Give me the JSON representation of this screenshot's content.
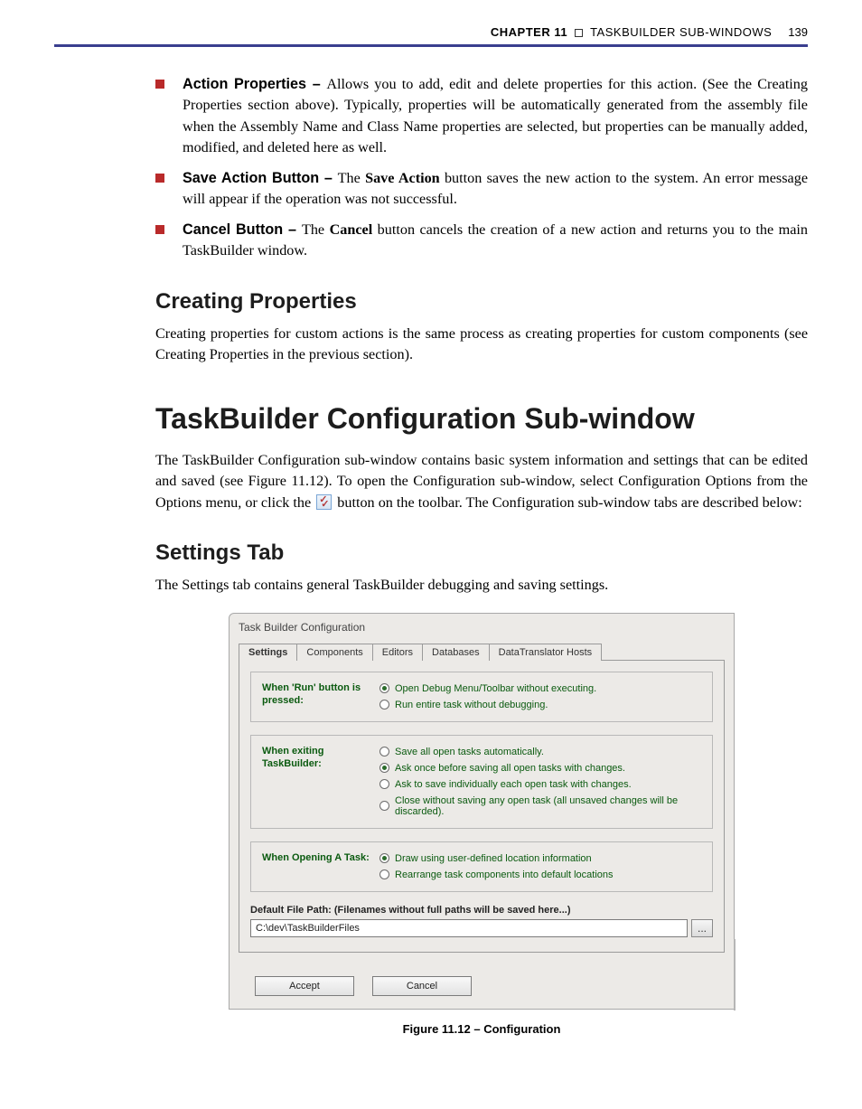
{
  "header": {
    "chapter_label": "CHAPTER 11",
    "chapter_title": "TASKBUILDER SUB-WINDOWS",
    "page_number": "139"
  },
  "bullets": [
    {
      "term": "Action Properties – ",
      "text": "Allows you to add, edit and delete properties for this action. (See the Creating Properties section above). Typically, properties will be automatically generated from the assembly file when the Assembly Name and Class Name properties are selected, but properties can be manually added, modified, and deleted here as well."
    },
    {
      "term": "Save Action Button – ",
      "pre": "The ",
      "strong": "Save Action",
      "post": " button saves the new action to the system. An error message will appear if the operation was not successful."
    },
    {
      "term": "Cancel Button – ",
      "pre": "The ",
      "strong": "Cancel",
      "post": " button cancels the creation of a new action and returns you to the main TaskBuilder window."
    }
  ],
  "sections": {
    "creating_properties_heading": "Creating Properties",
    "creating_properties_text": "Creating properties for custom actions is the same process as creating properties for custom components (see Creating Properties in the previous section).",
    "config_heading": "TaskBuilder Configuration Sub-window",
    "config_text_pre": "The TaskBuilder Configuration sub-window contains basic system information and settings that can be edited and saved (see Figure 11.12). To open the Configuration sub-window, select Configuration Options from the Options menu, or click the ",
    "config_text_post": " button on the toolbar. The Configuration sub-window tabs are described below:",
    "settings_tab_heading": "Settings Tab",
    "settings_tab_text": "The Settings tab contains general TaskBuilder debugging and saving settings."
  },
  "dialog": {
    "title": "Task Builder Configuration",
    "tabs": [
      "Settings",
      "Components",
      "Editors",
      "Databases",
      "DataTranslator Hosts"
    ],
    "active_tab": 0,
    "groups": [
      {
        "label": "When 'Run' button is pressed:",
        "options": [
          {
            "label": "Open Debug Menu/Toolbar without executing.",
            "selected": true
          },
          {
            "label": "Run entire task without debugging.",
            "selected": false
          }
        ]
      },
      {
        "label": "When exiting TaskBuilder:",
        "options": [
          {
            "label": "Save all open tasks automatically.",
            "selected": false
          },
          {
            "label": "Ask once before saving all open tasks with changes.",
            "selected": true
          },
          {
            "label": "Ask to save individually each open task with changes.",
            "selected": false
          },
          {
            "label": "Close without saving any open task (all unsaved changes will be discarded).",
            "selected": false
          }
        ]
      },
      {
        "label": "When Opening A Task:",
        "options": [
          {
            "label": "Draw using user-defined location information",
            "selected": true
          },
          {
            "label": "Rearrange task components into default locations",
            "selected": false
          }
        ]
      }
    ],
    "path_label": "Default File Path: (Filenames without full paths will be saved here...)",
    "path_value": "C:\\dev\\TaskBuilderFiles",
    "browse_label": "...",
    "accept_label": "Accept",
    "cancel_label": "Cancel"
  },
  "caption": "Figure 11.12 – Configuration"
}
